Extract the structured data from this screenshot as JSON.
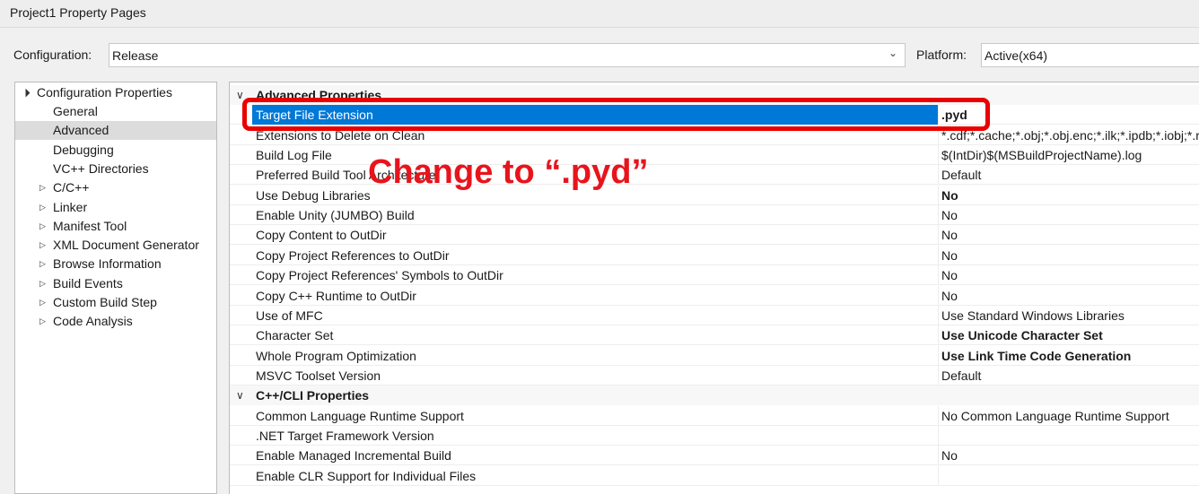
{
  "window": {
    "title": "Project1 Property Pages"
  },
  "configuration": {
    "label": "Configuration:",
    "value": "Release"
  },
  "platform": {
    "label": "Platform:",
    "value": "Active(x64)"
  },
  "tree": {
    "root": "Configuration Properties",
    "items": [
      {
        "label": "General",
        "expandable": false
      },
      {
        "label": "Advanced",
        "expandable": false,
        "selected": true
      },
      {
        "label": "Debugging",
        "expandable": false
      },
      {
        "label": "VC++ Directories",
        "expandable": false
      },
      {
        "label": "C/C++",
        "expandable": true
      },
      {
        "label": "Linker",
        "expandable": true
      },
      {
        "label": "Manifest Tool",
        "expandable": true
      },
      {
        "label": "XML Document Generator",
        "expandable": true
      },
      {
        "label": "Browse Information",
        "expandable": true
      },
      {
        "label": "Build Events",
        "expandable": true
      },
      {
        "label": "Custom Build Step",
        "expandable": true
      },
      {
        "label": "Code Analysis",
        "expandable": true
      }
    ]
  },
  "grid": {
    "categories": [
      {
        "title": "Advanced Properties",
        "rows": [
          {
            "name": "Target File Extension",
            "value": ".pyd",
            "bold": true,
            "selected": true
          },
          {
            "name": "Extensions to Delete on Clean",
            "value": "*.cdf;*.cache;*.obj;*.obj.enc;*.ilk;*.ipdb;*.iobj;*.res;*.lib",
            "bold": false
          },
          {
            "name": "Build Log File",
            "value": "$(IntDir)$(MSBuildProjectName).log",
            "bold": false
          },
          {
            "name": "Preferred Build Tool Architecture",
            "value": "Default",
            "bold": false
          },
          {
            "name": "Use Debug Libraries",
            "value": "No",
            "bold": true
          },
          {
            "name": "Enable Unity (JUMBO) Build",
            "value": "No",
            "bold": false
          },
          {
            "name": "Copy Content to OutDir",
            "value": "No",
            "bold": false
          },
          {
            "name": "Copy Project References to OutDir",
            "value": "No",
            "bold": false
          },
          {
            "name": "Copy Project References' Symbols to OutDir",
            "value": "No",
            "bold": false
          },
          {
            "name": "Copy C++ Runtime to OutDir",
            "value": "No",
            "bold": false
          },
          {
            "name": "Use of MFC",
            "value": "Use Standard Windows Libraries",
            "bold": false
          },
          {
            "name": "Character Set",
            "value": "Use Unicode Character Set",
            "bold": true
          },
          {
            "name": "Whole Program Optimization",
            "value": "Use Link Time Code Generation",
            "bold": true
          },
          {
            "name": "MSVC Toolset Version",
            "value": "Default",
            "bold": false
          }
        ]
      },
      {
        "title": "C++/CLI Properties",
        "rows": [
          {
            "name": "Common Language Runtime Support",
            "value": "No Common Language Runtime Support",
            "bold": false
          },
          {
            "name": ".NET Target Framework Version",
            "value": "",
            "bold": false
          },
          {
            "name": "Enable Managed Incremental Build",
            "value": "No",
            "bold": false
          },
          {
            "name": "Enable CLR Support for Individual Files",
            "value": "",
            "bold": false
          }
        ]
      }
    ]
  },
  "annotation": {
    "text": "Change to “.pyd”",
    "color": "#e8141c"
  },
  "colors": {
    "selection": "#0078d7",
    "highlight_box": "#ea0000"
  }
}
